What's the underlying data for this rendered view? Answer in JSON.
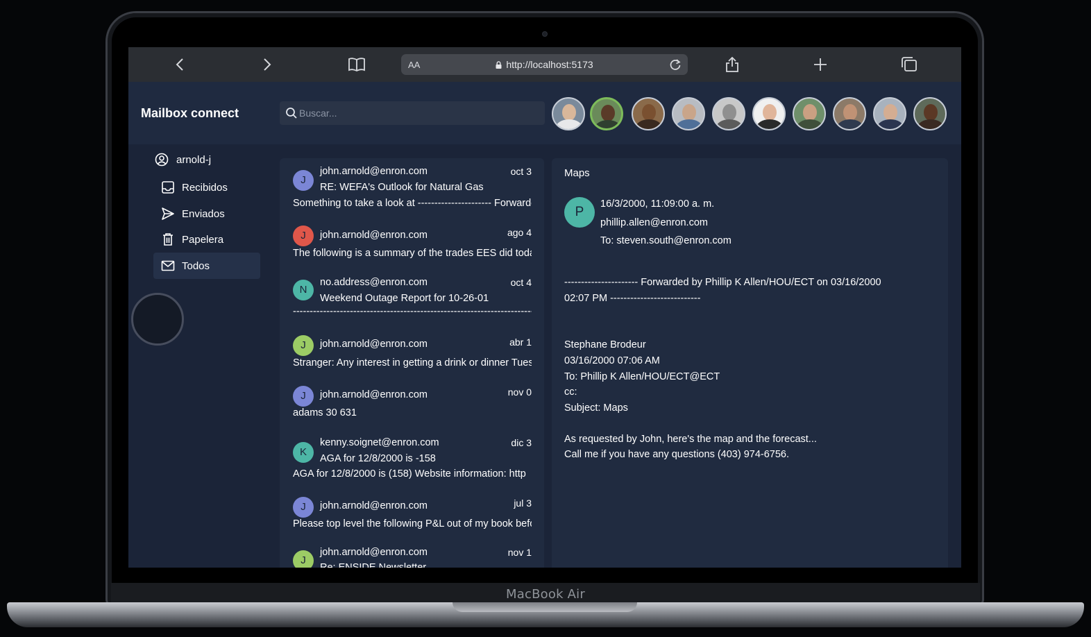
{
  "device": {
    "label": "MacBook Air"
  },
  "browser": {
    "text_size": "AA",
    "url": "http://localhost:5173"
  },
  "app": {
    "title": "Mailbox connect",
    "search": {
      "placeholder": "Buscar...",
      "value": ""
    },
    "account": "arnold-j",
    "nav": [
      {
        "label": "Recibidos",
        "icon": "inbox-icon"
      },
      {
        "label": "Enviados",
        "icon": "send-icon"
      },
      {
        "label": "Papelera",
        "icon": "trash-icon"
      },
      {
        "label": "Todos",
        "icon": "mail-icon",
        "selected": true
      }
    ],
    "avatars_selected_index": 1
  },
  "emails": [
    {
      "initial": "J",
      "color": "#7b86d6",
      "from": "john.arnold@enron.com",
      "date": "oct 3",
      "subject": "RE: WEFA's Outlook for Natural Gas",
      "preview": "Something to take a look at ---------------------- Forwarded"
    },
    {
      "initial": "J",
      "color": "#e0574a",
      "from": "john.arnold@enron.com",
      "date": "ago 4",
      "subject": "",
      "preview": "The following is a summary of the trades EES did today"
    },
    {
      "initial": "N",
      "color": "#4db6a6",
      "from": "no.address@enron.com",
      "date": "oct 4",
      "subject": "Weekend Outage Report for 10-26-01",
      "preview": "----------------------------------------------------------------------------------------------"
    },
    {
      "initial": "J",
      "color": "#9ccc65",
      "from": "john.arnold@enron.com",
      "date": "abr 1",
      "subject": "",
      "preview": "Stranger: Any interest in getting a drink or dinner Tuesday"
    },
    {
      "initial": "J",
      "color": "#7b86d6",
      "from": "john.arnold@enron.com",
      "date": "nov 0",
      "subject": "",
      "preview": "adams 30 631"
    },
    {
      "initial": "K",
      "color": "#4db6a6",
      "from": "kenny.soignet@enron.com",
      "date": "dic 3",
      "subject": "AGA for 12/8/2000 is -158",
      "preview": "AGA for 12/8/2000 is (158) Website information: http"
    },
    {
      "initial": "J",
      "color": "#7b86d6",
      "from": "john.arnold@enron.com",
      "date": "jul 3",
      "subject": "",
      "preview": "Please top level the following P&L out of my book before"
    },
    {
      "initial": "J",
      "color": "#9ccc65",
      "from": "john.arnold@enron.com",
      "date": "nov 1",
      "subject": "Re: ENSIDE Newsletter",
      "preview": ""
    }
  ],
  "reader": {
    "title": "Maps",
    "initial": "P",
    "datetime": "16/3/2000, 11:09:00 a. m.",
    "from": "phillip.allen@enron.com",
    "to": "To: steven.south@enron.com",
    "body": [
      "---------------------- Forwarded by Phillip K Allen/HOU/ECT on 03/16/2000",
      "02:07 PM ---------------------------",
      "",
      "",
      "Stephane Brodeur",
      "03/16/2000 07:06 AM",
      "To: Phillip K Allen/HOU/ECT@ECT",
      "cc:",
      "Subject: Maps",
      "",
      "As requested by John, here's the map and the forecast...",
      "Call me if you have any questions (403) 974-6756."
    ]
  }
}
